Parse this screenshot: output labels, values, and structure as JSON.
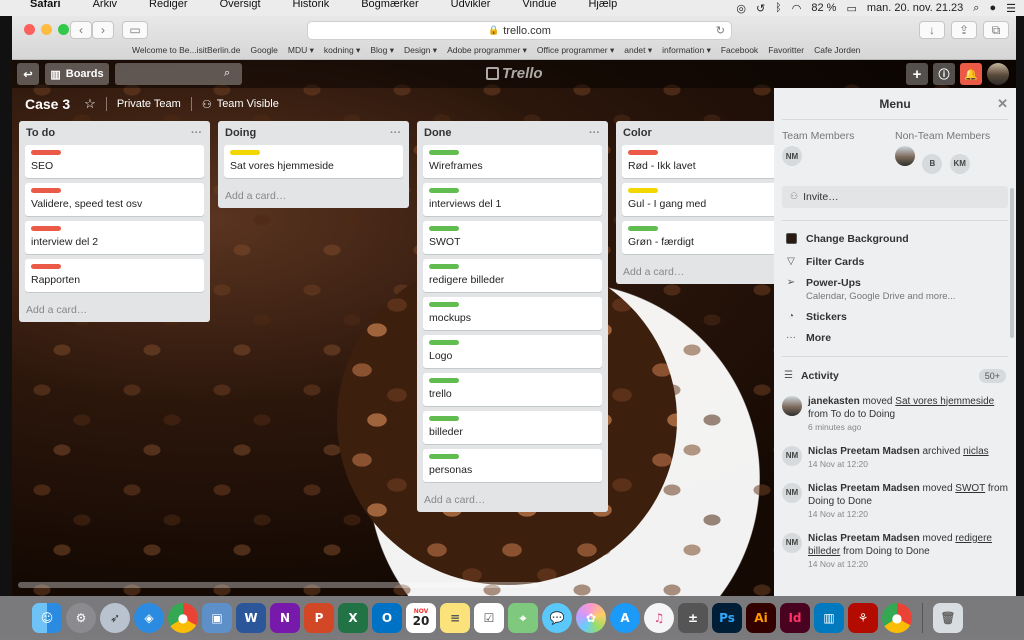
{
  "macmenu": {
    "apple": "",
    "items": [
      "Safari",
      "Arkiv",
      "Rediger",
      "Oversigt",
      "Historik",
      "Bogmærker",
      "Udvikler",
      "Vindue",
      "Hjælp"
    ],
    "battery": "82 %",
    "datetime": "man. 20. nov. 21.23"
  },
  "browser": {
    "url": "trello.com",
    "bookmarks": [
      "Welcome to Be...isitBerlin.de",
      "Google",
      "MDU ▾",
      "kodning ▾",
      "Blog ▾",
      "Design ▾",
      "Adobe programmer ▾",
      "Office programmer ▾",
      "andet ▾",
      "information ▾",
      "Facebook",
      "Favoritter",
      "Cafe Jorden"
    ]
  },
  "trello": {
    "boards_label": "Boards",
    "logo_text": "Trello",
    "board_title": "Case 3",
    "team": "Private Team",
    "visibility": "Team Visible",
    "add_card": "Add a card…",
    "lists": [
      {
        "title": "To do",
        "cards": [
          {
            "label": "#eb5a46",
            "title": "SEO"
          },
          {
            "label": "#eb5a46",
            "title": "Validere, speed test osv"
          },
          {
            "label": "#eb5a46",
            "title": "interview del 2"
          },
          {
            "label": "#eb5a46",
            "title": "Rapporten"
          }
        ]
      },
      {
        "title": "Doing",
        "cards": [
          {
            "label": "#f2d600",
            "title": "Sat vores hjemmeside"
          }
        ]
      },
      {
        "title": "Done",
        "cards": [
          {
            "label": "#61bd4f",
            "title": "Wireframes"
          },
          {
            "label": "#61bd4f",
            "title": "interviews del 1"
          },
          {
            "label": "#61bd4f",
            "title": "SWOT"
          },
          {
            "label": "#61bd4f",
            "title": "redigere billeder"
          },
          {
            "label": "#61bd4f",
            "title": "mockups"
          },
          {
            "label": "#61bd4f",
            "title": "Logo"
          },
          {
            "label": "#61bd4f",
            "title": "trello"
          },
          {
            "label": "#61bd4f",
            "title": "billeder"
          },
          {
            "label": "#61bd4f",
            "title": "personas"
          }
        ]
      },
      {
        "title": "Color",
        "cards": [
          {
            "label": "#eb5a46",
            "title": "Rød - Ikk lavet"
          },
          {
            "label": "#f2d600",
            "title": "Gul - I gang med"
          },
          {
            "label": "#61bd4f",
            "title": "Grøn - færdigt"
          }
        ]
      }
    ]
  },
  "menu": {
    "title": "Menu",
    "team_members_label": "Team Members",
    "non_team_members_label": "Non-Team Members",
    "team_members": [
      "NM"
    ],
    "non_team_members": [
      "",
      "B",
      "KM"
    ],
    "invite": "Invite…",
    "items": [
      {
        "label": "Change Background",
        "sub": ""
      },
      {
        "label": "Filter Cards",
        "sub": ""
      },
      {
        "label": "Power-Ups",
        "sub": "Calendar, Google Drive and more..."
      },
      {
        "label": "Stickers",
        "sub": ""
      },
      {
        "label": "More",
        "sub": ""
      }
    ],
    "activity_label": "Activity",
    "activity_count": "50+",
    "activity": [
      {
        "avatar": "",
        "who": "janekasten",
        "verb": " moved ",
        "link": "Sat vores hjemmeside",
        "rest": " from To do to Doing",
        "when": "6 minutes ago"
      },
      {
        "avatar": "NM",
        "who": "Niclas Preetam Madsen",
        "verb": " archived ",
        "link": "niclas",
        "rest": "",
        "when": "14 Nov at 12:20"
      },
      {
        "avatar": "NM",
        "who": "Niclas Preetam Madsen",
        "verb": " moved ",
        "link": "SWOT",
        "rest": " from Doing to Done",
        "when": "14 Nov at 12:20"
      },
      {
        "avatar": "NM",
        "who": "Niclas Preetam Madsen",
        "verb": " moved ",
        "link": "redigere billeder",
        "rest": " from Doing to Done",
        "when": "14 Nov at 12:20"
      }
    ]
  },
  "dock": {
    "calendar_month": "NOV",
    "calendar_day": "20",
    "icons": [
      "finder-icon",
      "system-preferences-icon",
      "launchpad-icon",
      "safari-icon",
      "chrome-icon",
      "preview-icon",
      "word-icon",
      "onenote-icon",
      "powerpoint-icon",
      "excel-icon",
      "outlook-icon",
      "calendar-icon",
      "notes-icon",
      "reminders-icon",
      "maps-icon",
      "messages-icon",
      "photos-icon",
      "app-store-icon",
      "itunes-icon",
      "calculator-icon",
      "photoshop-icon",
      "illustrator-icon",
      "indesign-icon",
      "trello-app-icon",
      "acrobat-icon",
      "chrome-icon-2",
      "trash-icon"
    ]
  }
}
